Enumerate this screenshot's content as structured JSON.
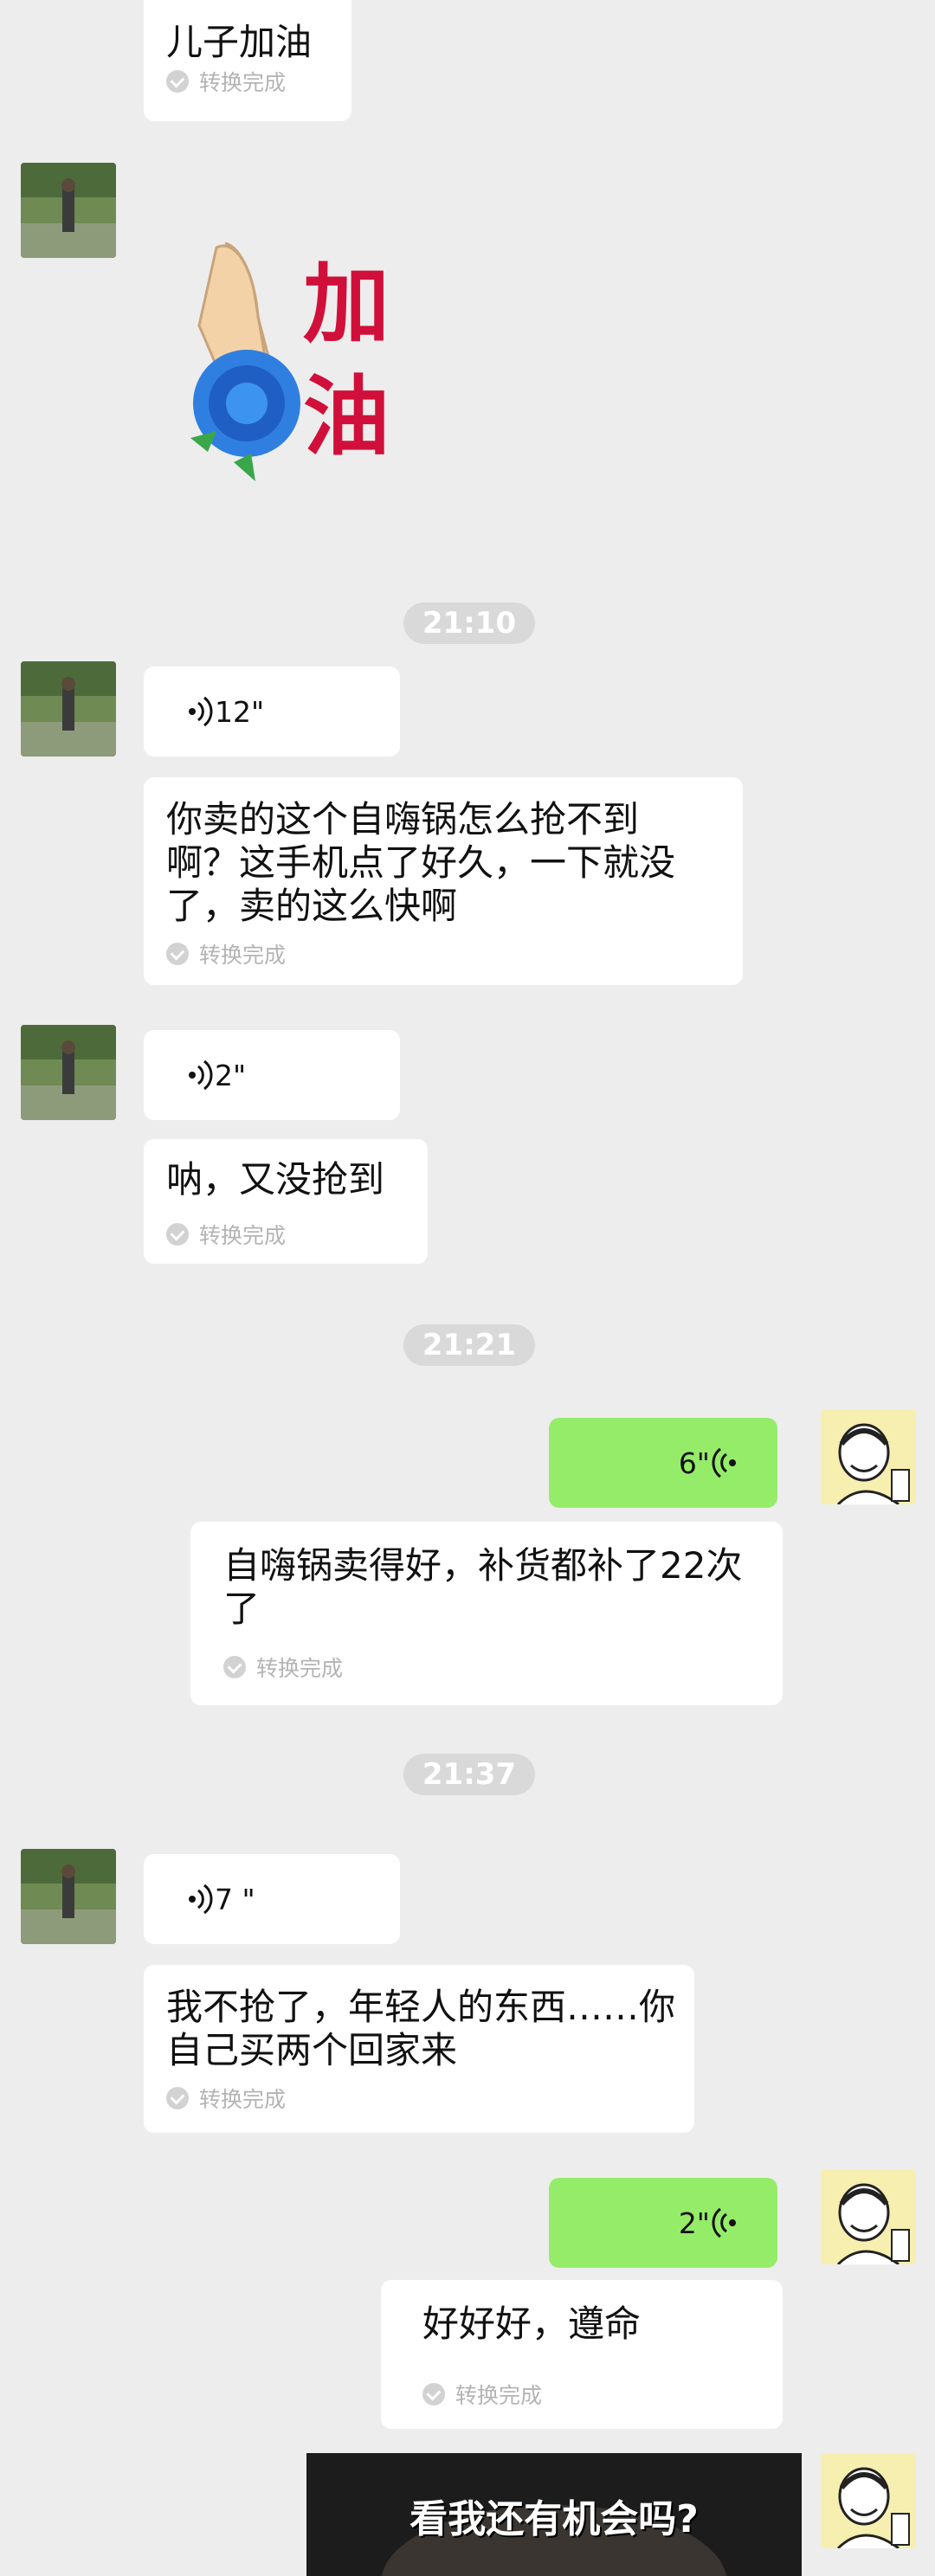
{
  "messages": {
    "m1": {
      "text": "儿子加油",
      "status": "转换完成"
    },
    "sticker": {
      "text": "加油"
    },
    "t1": "21:10",
    "m2": {
      "voice": "12\""
    },
    "m3": {
      "text": "你卖的这个自嗨锅怎么抢不到啊？这手机点了好久，一下就没了，卖的这么快啊",
      "status": "转换完成"
    },
    "m4": {
      "voice": "2\""
    },
    "m5": {
      "text": "呐，又没抢到",
      "status": "转换完成"
    },
    "t2": "21:21",
    "m6": {
      "voice": "6\""
    },
    "m7": {
      "text": "自嗨锅卖得好，补货都补了22次了",
      "status": "转换完成"
    },
    "t3": "21:37",
    "m8": {
      "voice": "7 \""
    },
    "m9": {
      "text": "我不抢了，年轻人的东西……你自己买两个回家来",
      "status": "转换完成"
    },
    "m10": {
      "voice": "2\""
    },
    "m11": {
      "text": "好好好，遵命",
      "status": "转换完成"
    },
    "image_msg": {
      "caption": "看我还有机会吗?"
    }
  },
  "colors": {
    "background": "#ededed",
    "bubble": "#ffffff",
    "my_bubble": "#95ec69"
  }
}
